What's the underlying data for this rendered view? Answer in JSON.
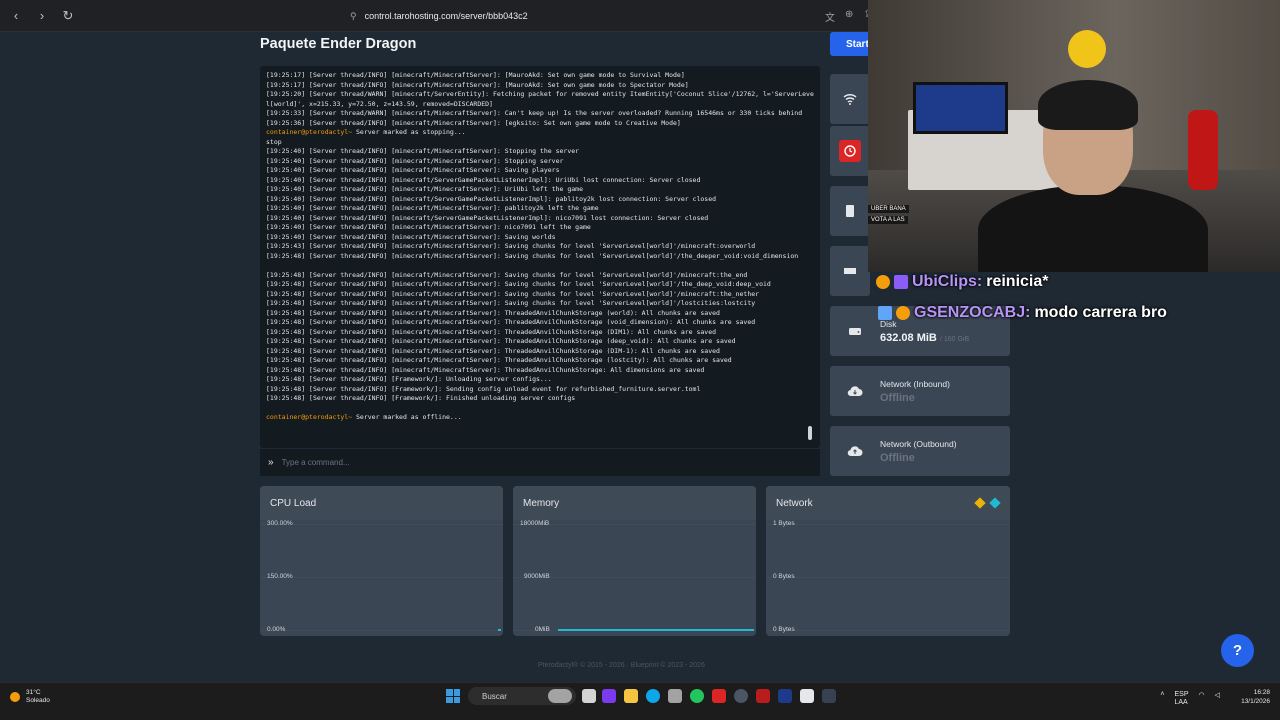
{
  "browser": {
    "url": "control.tarohosting.com/server/bbb043c2"
  },
  "page": {
    "title": "Paquete Ender Dragon",
    "start_label": "Start"
  },
  "console": {
    "lines": [
      {
        "t": "[19:25:17] [Server thread/INFO] [minecraft/MinecraftServer]: [MauroAkd: Set own game mode to Survival Mode]"
      },
      {
        "t": "[19:25:17] [Server thread/INFO] [minecraft/MinecraftServer]: [MauroAkd: Set own game mode to Spectator Mode]"
      },
      {
        "t": "[19:25:20] [Server thread/WARN] [minecraft/ServerEntity]: Fetching packet for removed entity ItemEntity['Coconut Slice'/12762, l='ServerLevel[world]', x=215.33, y=72.50, z=143.59, removed=DISCARDED]"
      },
      {
        "t": "[19:25:33] [Server thread/WARN] [minecraft/MinecraftServer]: Can't keep up! Is the server overloaded? Running 16546ms or 330 ticks behind"
      },
      {
        "t": "[19:25:36] [Server thread/INFO] [minecraft/MinecraftServer]: [egksito: Set own game mode to Creative Mode]"
      },
      {
        "p": "container@pterodactyl~",
        "t": " Server marked as stopping..."
      },
      {
        "t": "stop"
      },
      {
        "t": "[19:25:40] [Server thread/INFO] [minecraft/MinecraftServer]: Stopping the server"
      },
      {
        "t": "[19:25:40] [Server thread/INFO] [minecraft/MinecraftServer]: Stopping server"
      },
      {
        "t": "[19:25:40] [Server thread/INFO] [minecraft/MinecraftServer]: Saving players"
      },
      {
        "t": "[19:25:40] [Server thread/INFO] [minecraft/ServerGamePacketListenerImpl]: UriUbi lost connection: Server closed"
      },
      {
        "t": "[19:25:40] [Server thread/INFO] [minecraft/MinecraftServer]: UriUbi left the game"
      },
      {
        "t": "[19:25:40] [Server thread/INFO] [minecraft/ServerGamePacketListenerImpl]: pablitoy2k lost connection: Server closed"
      },
      {
        "t": "[19:25:40] [Server thread/INFO] [minecraft/MinecraftServer]: pablitoy2k left the game"
      },
      {
        "t": "[19:25:40] [Server thread/INFO] [minecraft/ServerGamePacketListenerImpl]: nico7091 lost connection: Server closed"
      },
      {
        "t": "[19:25:40] [Server thread/INFO] [minecraft/MinecraftServer]: nico7091 left the game"
      },
      {
        "t": "[19:25:40] [Server thread/INFO] [minecraft/MinecraftServer]: Saving worlds"
      },
      {
        "t": "[19:25:43] [Server thread/INFO] [minecraft/MinecraftServer]: Saving chunks for level 'ServerLevel[world]'/minecraft:overworld"
      },
      {
        "t": "[19:25:48] [Server thread/INFO] [minecraft/MinecraftServer]: Saving chunks for level 'ServerLevel[world]'/the_deeper_void:void_dimension"
      },
      {
        "t": " "
      },
      {
        "t": "[19:25:48] [Server thread/INFO] [minecraft/MinecraftServer]: Saving chunks for level 'ServerLevel[world]'/minecraft:the_end"
      },
      {
        "t": "[19:25:48] [Server thread/INFO] [minecraft/MinecraftServer]: Saving chunks for level 'ServerLevel[world]'/the_deep_void:deep_void"
      },
      {
        "t": "[19:25:48] [Server thread/INFO] [minecraft/MinecraftServer]: Saving chunks for level 'ServerLevel[world]'/minecraft:the_nether"
      },
      {
        "t": "[19:25:48] [Server thread/INFO] [minecraft/MinecraftServer]: Saving chunks for level 'ServerLevel[world]'/lostcities:lostcity"
      },
      {
        "t": "[19:25:48] [Server thread/INFO] [minecraft/MinecraftServer]: ThreadedAnvilChunkStorage (world): All chunks are saved"
      },
      {
        "t": "[19:25:48] [Server thread/INFO] [minecraft/MinecraftServer]: ThreadedAnvilChunkStorage (void_dimension): All chunks are saved"
      },
      {
        "t": "[19:25:48] [Server thread/INFO] [minecraft/MinecraftServer]: ThreadedAnvilChunkStorage (DIM1): All chunks are saved"
      },
      {
        "t": "[19:25:48] [Server thread/INFO] [minecraft/MinecraftServer]: ThreadedAnvilChunkStorage (deep_void): All chunks are saved"
      },
      {
        "t": "[19:25:48] [Server thread/INFO] [minecraft/MinecraftServer]: ThreadedAnvilChunkStorage (DIM-1): All chunks are saved"
      },
      {
        "t": "[19:25:48] [Server thread/INFO] [minecraft/MinecraftServer]: ThreadedAnvilChunkStorage (lostcity): All chunks are saved"
      },
      {
        "t": "[19:25:48] [Server thread/INFO] [minecraft/MinecraftServer]: ThreadedAnvilChunkStorage: All dimensions are saved"
      },
      {
        "t": "[19:25:48] [Server thread/INFO] [Framework/]: Unloading server configs..."
      },
      {
        "t": "[19:25:48] [Server thread/INFO] [Framework/]: Sending config unload event for refurbished_furniture.server.toml"
      },
      {
        "t": "[19:25:48] [Server thread/INFO] [Framework/]: Finished unloading server configs"
      },
      {
        "t": " "
      },
      {
        "p": "container@pterodactyl~",
        "t": " Server marked as offline..."
      }
    ],
    "command_placeholder": "Type a command..."
  },
  "stats": {
    "disk_label": "Disk",
    "disk_value": "632.08 MiB",
    "disk_limit": "/ 160 GiB",
    "net_in_label": "Network (Inbound)",
    "net_in_value": "Offline",
    "net_out_label": "Network (Outbound)",
    "net_out_value": "Offline"
  },
  "graphs": {
    "cpu": {
      "title": "CPU Load",
      "ticks": [
        "300.00%",
        "150.00%",
        "0.00%"
      ]
    },
    "memory": {
      "title": "Memory",
      "ticks": [
        "18000MiB",
        "9000MiB",
        "0MiB"
      ]
    },
    "network": {
      "title": "Network",
      "ticks": [
        "1 Bytes",
        "0 Bytes",
        "0 Bytes"
      ]
    }
  },
  "footer": {
    "text": "Pterodactyl® © 2015 - 2026 · Blueprint © 2023 - 2026"
  },
  "help_label": "?",
  "stream": {
    "overlay_a": "UBER BANA",
    "overlay_b": "VOTA A LAS",
    "chat": [
      {
        "user": "UbiClips:",
        "msg": "reinicia*"
      },
      {
        "user": "GSENZOCABJ:",
        "msg": "modo carrera bro"
      }
    ]
  },
  "taskbar": {
    "weather_temp": "31°C",
    "weather_desc": "Soleado",
    "search": "Buscar",
    "lang": "ESP",
    "lang2": "LAA",
    "time": "16:28",
    "date": "13/1/2026"
  },
  "colors": {
    "accent": "#2563eb",
    "panel": "#3a4653",
    "console_bg": "#131a20",
    "series": "#22b8cf"
  }
}
